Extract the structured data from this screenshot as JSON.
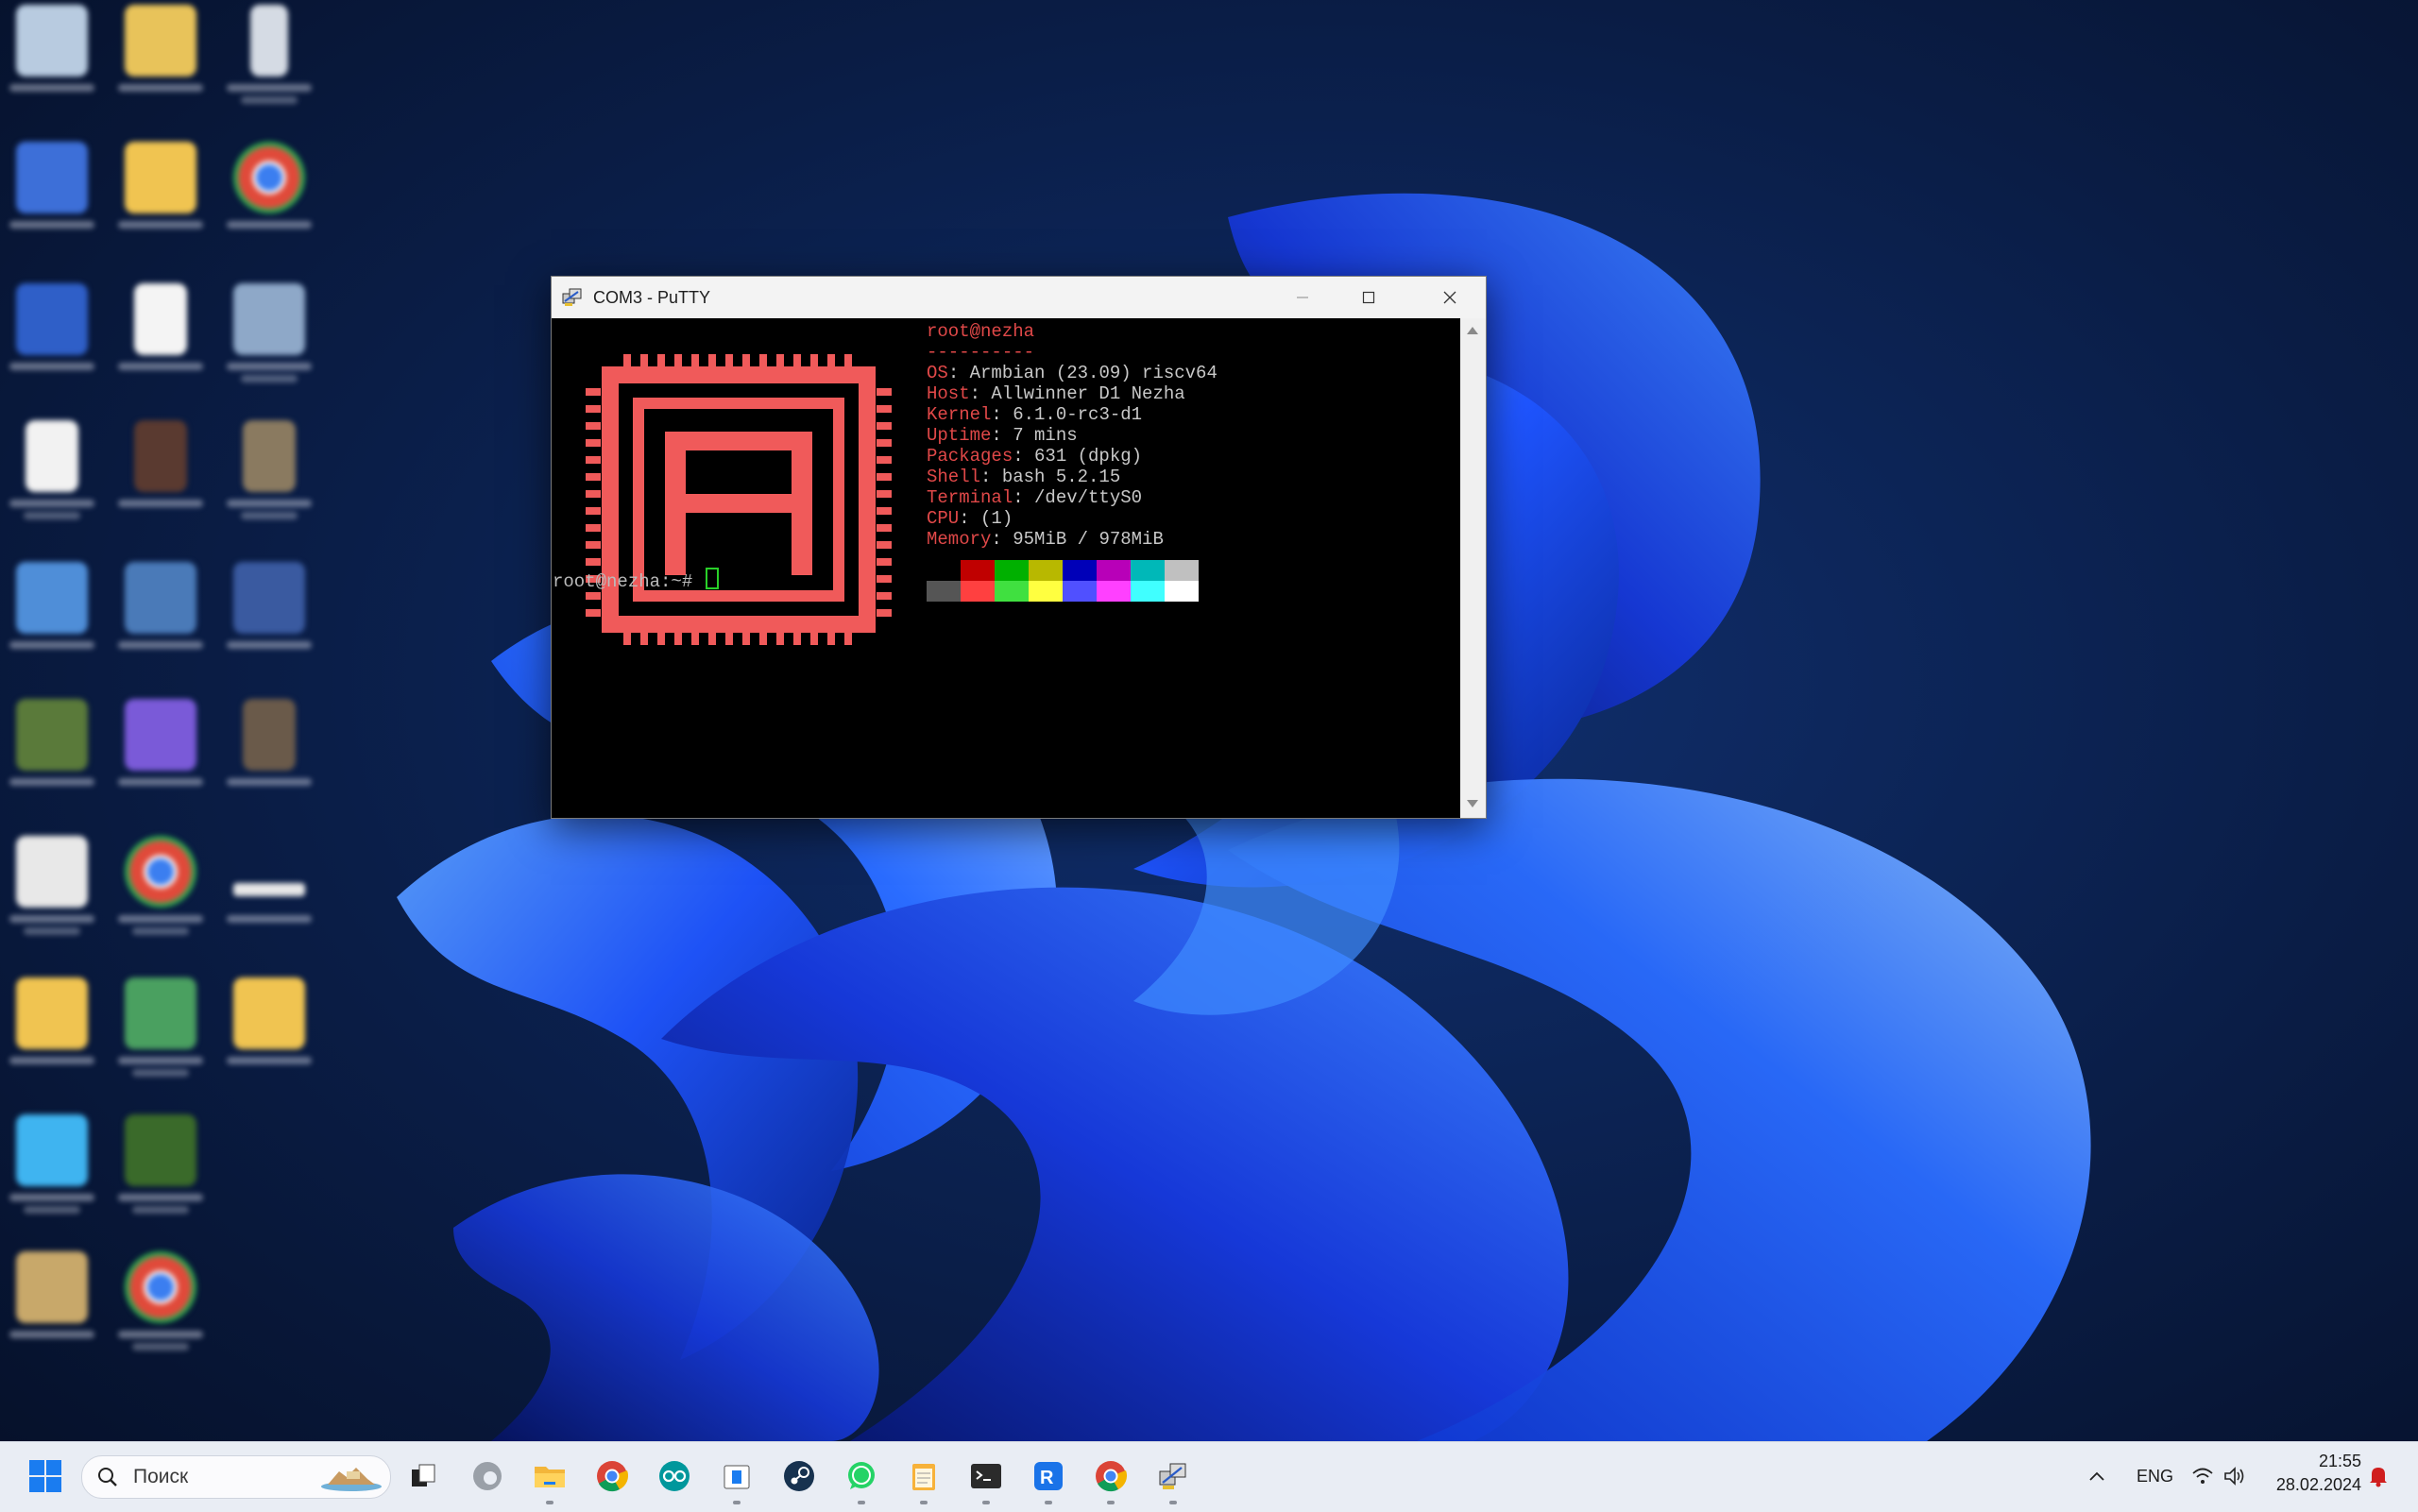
{
  "window": {
    "title": "COM3 - PuTTY",
    "controls": {
      "minimize": "minimize",
      "maximize": "maximize",
      "close": "close"
    }
  },
  "terminal": {
    "userhost": "root@nezha",
    "separator": "----------",
    "info": [
      {
        "key": "OS",
        "value": ": Armbian (23.09) riscv64"
      },
      {
        "key": "Host",
        "value": ": Allwinner D1 Nezha"
      },
      {
        "key": "Kernel",
        "value": ": 6.1.0-rc3-d1"
      },
      {
        "key": "Uptime",
        "value": ": 7 mins"
      },
      {
        "key": "Packages",
        "value": ": 631 (dpkg)"
      },
      {
        "key": "Shell",
        "value": ": bash 5.2.15"
      },
      {
        "key": "Terminal",
        "value": ": /dev/ttyS0"
      },
      {
        "key": "CPU",
        "value": ": (1)"
      },
      {
        "key": "Memory",
        "value": ": 95MiB / 978MiB"
      }
    ],
    "palette_top": [
      "#000000",
      "#c00000",
      "#00b000",
      "#b8b800",
      "#0000b8",
      "#b800b8",
      "#00b8b8",
      "#c0c0c0"
    ],
    "palette_bottom": [
      "#555555",
      "#ff4040",
      "#40e040",
      "#ffff40",
      "#5050ff",
      "#ff40ff",
      "#40ffff",
      "#ffffff"
    ],
    "prompt": "root@nezha:~# ",
    "logo_color": "#f05a5a"
  },
  "taskbar": {
    "search_placeholder": "Поиск",
    "language": "ENG",
    "time": "21:55",
    "date": "28.02.2024",
    "apps": [
      "start-icon",
      "task-view-icon",
      "edge-icon",
      "file-explorer-icon",
      "chrome-icon",
      "arduino-icon",
      "store-icon",
      "steam-icon",
      "whatsapp-icon",
      "notepad-icon",
      "terminal-icon",
      "rstudio-icon",
      "chrome-icon",
      "network-tool-icon"
    ]
  },
  "colors": {
    "accent": "#2463ff",
    "terminal_red": "#e04848"
  }
}
